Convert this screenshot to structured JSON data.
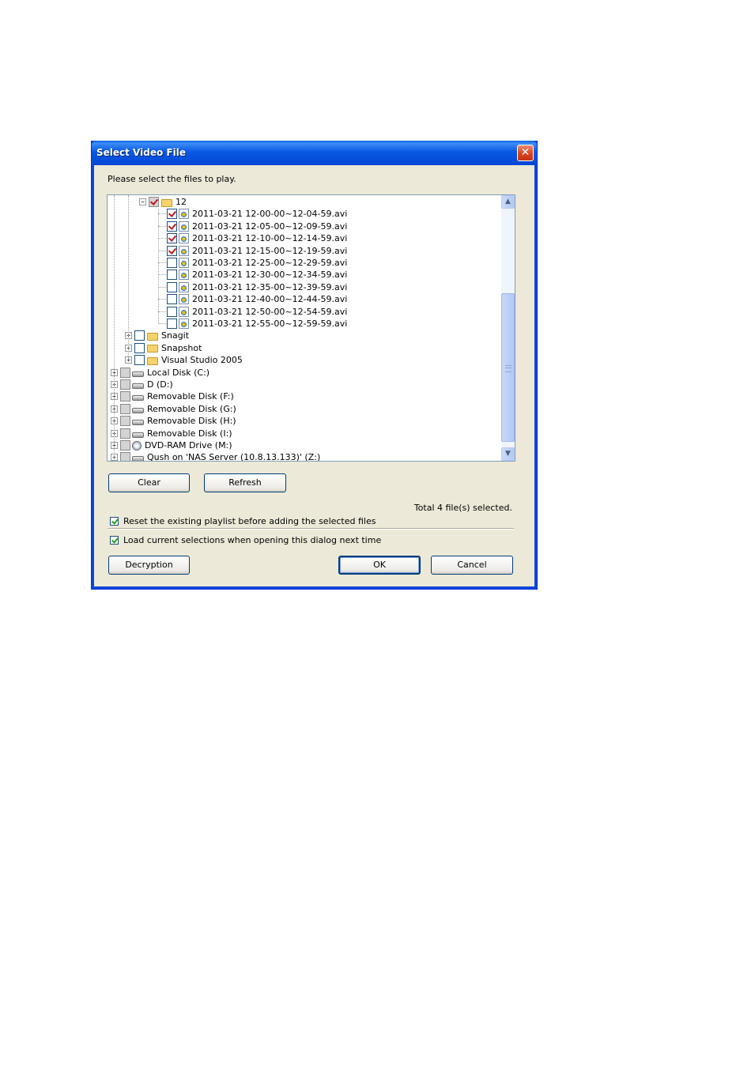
{
  "dialog": {
    "title": "Select Video File",
    "close_glyph": "✕",
    "prompt": "Please select the files to play."
  },
  "tree": {
    "folder": {
      "name": "12",
      "state": "partial"
    },
    "files": [
      {
        "name": "2011-03-21 12-00-00~12-04-59.avi",
        "checked": true
      },
      {
        "name": "2011-03-21 12-05-00~12-09-59.avi",
        "checked": true
      },
      {
        "name": "2011-03-21 12-10-00~12-14-59.avi",
        "checked": true
      },
      {
        "name": "2011-03-21 12-15-00~12-19-59.avi",
        "checked": true
      },
      {
        "name": "2011-03-21 12-25-00~12-29-59.avi",
        "checked": false
      },
      {
        "name": "2011-03-21 12-30-00~12-34-59.avi",
        "checked": false
      },
      {
        "name": "2011-03-21 12-35-00~12-39-59.avi",
        "checked": false
      },
      {
        "name": "2011-03-21 12-40-00~12-44-59.avi",
        "checked": false
      },
      {
        "name": "2011-03-21 12-50-00~12-54-59.avi",
        "checked": false
      },
      {
        "name": "2011-03-21 12-55-00~12-59-59.avi",
        "checked": false
      }
    ],
    "subfolders": [
      {
        "name": "Snagit"
      },
      {
        "name": "Snapshot"
      },
      {
        "name": "Visual Studio 2005"
      }
    ],
    "drives": [
      {
        "name": "Local Disk (C:)",
        "icon": "hard-disk-icon"
      },
      {
        "name": "D (D:)",
        "icon": "hard-disk-icon"
      },
      {
        "name": "Removable Disk (F:)",
        "icon": "removable-disk-icon"
      },
      {
        "name": "Removable Disk (G:)",
        "icon": "removable-disk-icon"
      },
      {
        "name": "Removable Disk (H:)",
        "icon": "removable-disk-icon"
      },
      {
        "name": "Removable Disk (I:)",
        "icon": "removable-disk-icon"
      },
      {
        "name": "DVD-RAM Drive (M:)",
        "icon": "dvd-drive-icon"
      },
      {
        "name": "Qush on 'NAS Server (10.8.13.133)' (Z:)",
        "icon": "network-drive-icon"
      }
    ],
    "expand_glyph": "+",
    "collapse_glyph": "−",
    "scroll_up_glyph": "▲",
    "scroll_down_glyph": "▼"
  },
  "buttons": {
    "clear": "Clear",
    "refresh": "Refresh",
    "decryption": "Decryption",
    "ok": "OK",
    "cancel": "Cancel"
  },
  "status": {
    "total_selected": "Total 4 file(s) selected."
  },
  "options": {
    "reset_playlist": {
      "label": "Reset the existing playlist before adding the selected files",
      "checked": true
    },
    "load_selections": {
      "label": "Load current selections when opening this dialog next time",
      "checked": true
    }
  }
}
